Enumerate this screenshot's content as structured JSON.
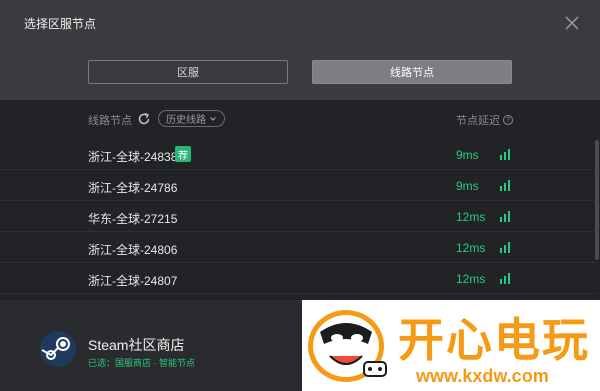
{
  "header": {
    "title": "选择区服节点"
  },
  "tabs": {
    "region": "区服",
    "line": "线路节点"
  },
  "list_header": {
    "name": "线路节点",
    "history": "历史线路",
    "delay": "节点延迟"
  },
  "rows": [
    {
      "name": "浙江-全球-24838",
      "badge": "荐",
      "ms": "9ms"
    },
    {
      "name": "浙江-全球-24786",
      "ms": "9ms"
    },
    {
      "name": "华东-全球-27215",
      "ms": "12ms"
    },
    {
      "name": "浙江-全球-24806",
      "ms": "12ms"
    },
    {
      "name": "浙江-全球-24807",
      "ms": "12ms"
    }
  ],
  "footer": {
    "store": "Steam社区商店",
    "selected": "已选：国服商店 · 智能节点"
  },
  "watermark": {
    "title": "开心电玩",
    "url": "www.kxdw.com"
  },
  "colors": {
    "accent": "#2bc97f",
    "badge": "#2bb673",
    "watermark": "#f59a12"
  }
}
